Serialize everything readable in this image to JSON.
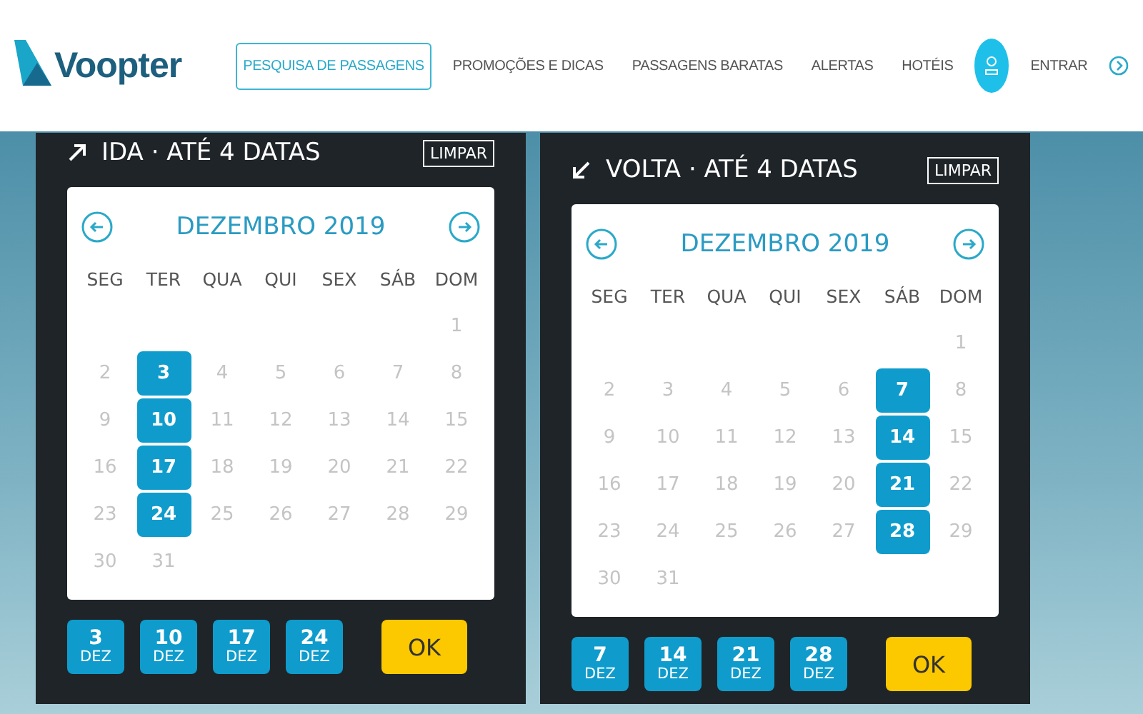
{
  "header": {
    "logo": "Voopter",
    "nav": [
      {
        "label": "PESQUISA DE PASSAGENS",
        "selected": true
      },
      {
        "label": "PROMOÇÕES E DICAS",
        "selected": false
      },
      {
        "label": "PASSAGENS BARATAS",
        "selected": false
      },
      {
        "label": "ALERTAS",
        "selected": false
      },
      {
        "label": "HOTÉIS",
        "selected": false
      }
    ],
    "login": "ENTRAR"
  },
  "panels": [
    {
      "kind": "outbound",
      "title": "IDA · ATÉ 4 DATAS",
      "clear": "LIMPAR",
      "month": "DEZEMBRO 2019",
      "weekdays": [
        "SEG",
        "TER",
        "QUA",
        "QUI",
        "SEX",
        "SÁB",
        "DOM"
      ],
      "weeks": [
        {
          "kind": "first",
          "days": [
            {
              "day": "1",
              "selected": false
            }
          ]
        },
        {
          "kind": "normal",
          "days": [
            {
              "day": "2",
              "selected": false
            },
            {
              "day": "3",
              "selected": true
            },
            {
              "day": "4",
              "selected": false
            },
            {
              "day": "5",
              "selected": false
            },
            {
              "day": "6",
              "selected": false
            },
            {
              "day": "7",
              "selected": false
            },
            {
              "day": "8",
              "selected": false
            }
          ]
        },
        {
          "kind": "normal",
          "days": [
            {
              "day": "9",
              "selected": false
            },
            {
              "day": "10",
              "selected": true
            },
            {
              "day": "11",
              "selected": false
            },
            {
              "day": "12",
              "selected": false
            },
            {
              "day": "13",
              "selected": false
            },
            {
              "day": "14",
              "selected": false
            },
            {
              "day": "15",
              "selected": false
            }
          ]
        },
        {
          "kind": "normal",
          "days": [
            {
              "day": "16",
              "selected": false
            },
            {
              "day": "17",
              "selected": true
            },
            {
              "day": "18",
              "selected": false
            },
            {
              "day": "19",
              "selected": false
            },
            {
              "day": "20",
              "selected": false
            },
            {
              "day": "21",
              "selected": false
            },
            {
              "day": "22",
              "selected": false
            }
          ]
        },
        {
          "kind": "normal",
          "days": [
            {
              "day": "23",
              "selected": false
            },
            {
              "day": "24",
              "selected": true
            },
            {
              "day": "25",
              "selected": false
            },
            {
              "day": "26",
              "selected": false
            },
            {
              "day": "27",
              "selected": false
            },
            {
              "day": "28",
              "selected": false
            },
            {
              "day": "29",
              "selected": false
            }
          ]
        },
        {
          "kind": "normal",
          "days": [
            {
              "day": "30",
              "selected": false
            },
            {
              "day": "31",
              "selected": false
            }
          ]
        }
      ],
      "chips": [
        {
          "day": "3",
          "month": "DEZ"
        },
        {
          "day": "10",
          "month": "DEZ"
        },
        {
          "day": "17",
          "month": "DEZ"
        },
        {
          "day": "24",
          "month": "DEZ"
        }
      ],
      "ok": "OK"
    },
    {
      "kind": "return",
      "title": "VOLTA · ATÉ 4 DATAS",
      "clear": "LIMPAR",
      "month": "DEZEMBRO 2019",
      "weekdays": [
        "SEG",
        "TER",
        "QUA",
        "QUI",
        "SEX",
        "SÁB",
        "DOM"
      ],
      "weeks": [
        {
          "kind": "first",
          "days": [
            {
              "day": "1",
              "selected": false
            }
          ]
        },
        {
          "kind": "normal",
          "days": [
            {
              "day": "2",
              "selected": false
            },
            {
              "day": "3",
              "selected": false
            },
            {
              "day": "4",
              "selected": false
            },
            {
              "day": "5",
              "selected": false
            },
            {
              "day": "6",
              "selected": false
            },
            {
              "day": "7",
              "selected": true
            },
            {
              "day": "8",
              "selected": false
            }
          ]
        },
        {
          "kind": "normal",
          "days": [
            {
              "day": "9",
              "selected": false
            },
            {
              "day": "10",
              "selected": false
            },
            {
              "day": "11",
              "selected": false
            },
            {
              "day": "12",
              "selected": false
            },
            {
              "day": "13",
              "selected": false
            },
            {
              "day": "14",
              "selected": true
            },
            {
              "day": "15",
              "selected": false
            }
          ]
        },
        {
          "kind": "normal",
          "days": [
            {
              "day": "16",
              "selected": false
            },
            {
              "day": "17",
              "selected": false
            },
            {
              "day": "18",
              "selected": false
            },
            {
              "day": "19",
              "selected": false
            },
            {
              "day": "20",
              "selected": false
            },
            {
              "day": "21",
              "selected": true
            },
            {
              "day": "22",
              "selected": false
            }
          ]
        },
        {
          "kind": "normal",
          "days": [
            {
              "day": "23",
              "selected": false
            },
            {
              "day": "24",
              "selected": false
            },
            {
              "day": "25",
              "selected": false
            },
            {
              "day": "26",
              "selected": false
            },
            {
              "day": "27",
              "selected": false
            },
            {
              "day": "28",
              "selected": true
            },
            {
              "day": "29",
              "selected": false
            }
          ]
        },
        {
          "kind": "normal",
          "days": [
            {
              "day": "30",
              "selected": false
            },
            {
              "day": "31",
              "selected": false
            }
          ]
        }
      ],
      "chips": [
        {
          "day": "7",
          "month": "DEZ"
        },
        {
          "day": "14",
          "month": "DEZ"
        },
        {
          "day": "21",
          "month": "DEZ"
        },
        {
          "day": "28",
          "month": "DEZ"
        }
      ],
      "ok": "OK"
    }
  ]
}
